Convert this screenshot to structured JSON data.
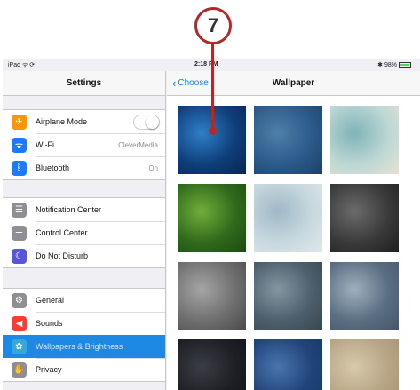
{
  "callout": {
    "number": "7"
  },
  "status": {
    "device": "iPad ᯤ ⟳",
    "time": "2:18 PM",
    "battery": "✱ 98%"
  },
  "sidebar": {
    "title": "Settings",
    "groups": [
      [
        {
          "label": "Airplane Mode",
          "icon": "airplane-icon",
          "color": "#ff9500",
          "control": "toggle"
        },
        {
          "label": "Wi-Fi",
          "icon": "wifi-icon",
          "color": "#1a7bff",
          "value": "CleverMedia"
        },
        {
          "label": "Bluetooth",
          "icon": "bluetooth-icon",
          "color": "#1a7bff",
          "value": "On"
        }
      ],
      [
        {
          "label": "Notification Center",
          "icon": "notification-center-icon",
          "color": "#8e8e93"
        },
        {
          "label": "Control Center",
          "icon": "control-center-icon",
          "color": "#8e8e93"
        },
        {
          "label": "Do Not Disturb",
          "icon": "moon-icon",
          "color": "#5856d6"
        }
      ],
      [
        {
          "label": "General",
          "icon": "gear-icon",
          "color": "#8e8e93"
        },
        {
          "label": "Sounds",
          "icon": "speaker-icon",
          "color": "#ff3b30"
        },
        {
          "label": "Wallpapers & Brightness",
          "icon": "wallpaper-icon",
          "color": "#34aadc",
          "selected": true
        },
        {
          "label": "Privacy",
          "icon": "hand-icon",
          "color": "#8e8e93"
        }
      ]
    ]
  },
  "detail": {
    "back_label": "Choose",
    "title": "Wallpaper",
    "wallpapers": [
      {
        "name": "wallpaper-blue-wave",
        "colors": [
          "#0f3e7a",
          "#2f7fc8",
          "#0a2450"
        ]
      },
      {
        "name": "wallpaper-deep-water",
        "colors": [
          "#2c5a8a",
          "#4f7faa",
          "#1d4066"
        ]
      },
      {
        "name": "wallpaper-beach",
        "colors": [
          "#bcd7d4",
          "#7fb3b8",
          "#e6e2d3"
        ]
      },
      {
        "name": "wallpaper-grass",
        "colors": [
          "#2f6a1c",
          "#6fae3a",
          "#1c4a10"
        ]
      },
      {
        "name": "wallpaper-birds-sky",
        "colors": [
          "#c8d8df",
          "#9fb9c6",
          "#dfe8ea"
        ]
      },
      {
        "name": "wallpaper-dark-sand",
        "colors": [
          "#3a3a3a",
          "#6b6b6b",
          "#1f1f1f"
        ]
      },
      {
        "name": "wallpaper-sand-ripples",
        "colors": [
          "#6f6f6f",
          "#a5a5a5",
          "#4a4a4a"
        ]
      },
      {
        "name": "wallpaper-blue-rock",
        "colors": [
          "#4d5f6c",
          "#8496a2",
          "#38474f"
        ]
      },
      {
        "name": "wallpaper-pebbles",
        "colors": [
          "#5a6e82",
          "#9fb0bd",
          "#465666"
        ]
      },
      {
        "name": "wallpaper-dark-fabric",
        "colors": [
          "#1d1f24",
          "#3a3d44",
          "#121317"
        ]
      },
      {
        "name": "wallpaper-denim",
        "colors": [
          "#20447a",
          "#4b74ad",
          "#163566"
        ]
      },
      {
        "name": "wallpaper-linen",
        "colors": [
          "#b7a585",
          "#d8c9ad",
          "#a39273"
        ]
      }
    ]
  }
}
